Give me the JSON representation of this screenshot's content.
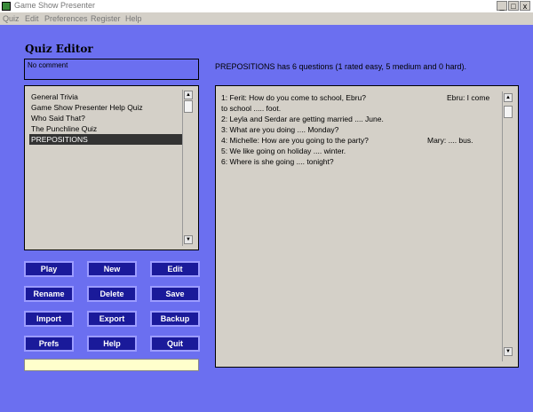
{
  "window": {
    "title": "Game Show Presenter",
    "controls": [
      "_",
      "□",
      "x"
    ]
  },
  "menu": [
    "Quiz",
    "Edit",
    "Preferences",
    "Register",
    "Help"
  ],
  "editor": {
    "title": "Quiz Editor",
    "comment": "No comment",
    "summary": "PREPOSITIONS has 6 questions (1 rated easy, 5 medium and 0 hard)."
  },
  "quizzes": [
    {
      "label": "General Trivia",
      "selected": false
    },
    {
      "label": "Game Show Presenter Help Quiz",
      "selected": false
    },
    {
      "label": "Who Said That?",
      "selected": false
    },
    {
      "label": "The Punchline Quiz",
      "selected": false
    },
    {
      "label": "PREPOSITIONS",
      "selected": true
    }
  ],
  "buttons": {
    "play": "Play",
    "new": "New",
    "edit": "Edit",
    "rename": "Rename",
    "delete": "Delete",
    "save": "Save",
    "import": "Import",
    "export": "Export",
    "backup": "Backup",
    "prefs": "Prefs",
    "help": "Help",
    "quit": "Quit"
  },
  "questions": [
    {
      "text": "1: Ferit: How do you come to school, Ebru?",
      "extra": "Ebru: I come"
    },
    {
      "text": "to school ..... foot.",
      "extra": ""
    },
    {
      "text": "2: Leyla and Serdar are getting married .... June.",
      "extra": ""
    },
    {
      "text": "3: What are you doing .... Monday?",
      "extra": ""
    },
    {
      "text": "4: Michelle: How are you going to the party?",
      "extra": "Mary: .... bus."
    },
    {
      "text": "5: We like going on holiday .... winter.",
      "extra": ""
    },
    {
      "text": "6: Where is she going .... tonight?",
      "extra": ""
    }
  ],
  "colors": {
    "background": "#6b6ff0",
    "button": "#1a1a9a",
    "button_border": "#9c9cff",
    "list_bg": "#d4d0c8",
    "status_bg": "#ffffcc"
  }
}
